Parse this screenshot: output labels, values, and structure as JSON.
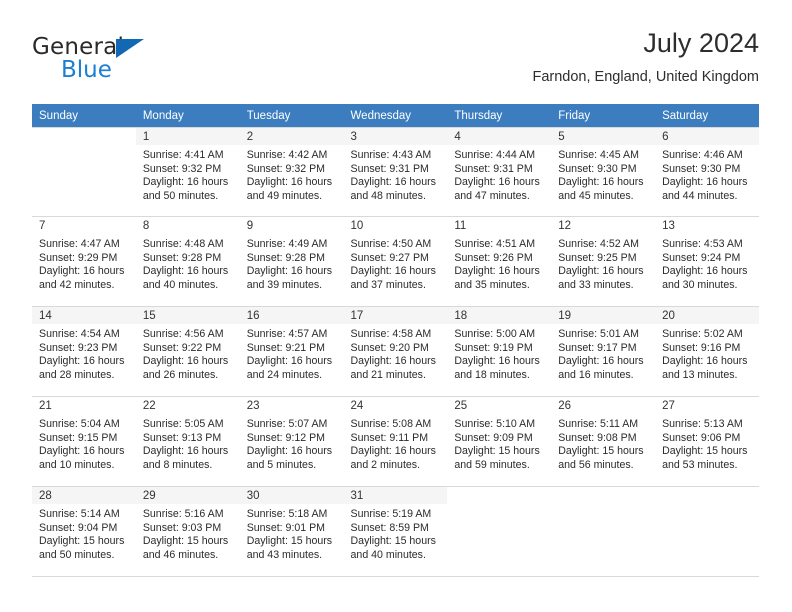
{
  "brand": {
    "line1": "General",
    "line2": "Blue",
    "triangle_color": "#1268b3",
    "blue_color": "#1b7fd4"
  },
  "header": {
    "title": "July 2024",
    "subtitle": "Farndon, England, United Kingdom"
  },
  "theme": {
    "header_row_bg": "#3b7dbf",
    "header_row_text": "#ffffff",
    "alt_row_bg": "#f5f5f5",
    "grid_line": "#d9d9d9"
  },
  "weekdays": [
    "Sunday",
    "Monday",
    "Tuesday",
    "Wednesday",
    "Thursday",
    "Friday",
    "Saturday"
  ],
  "weeks": [
    [
      {
        "day": "",
        "sunrise": "",
        "sunset": "",
        "daylight1": "",
        "daylight2": ""
      },
      {
        "day": "1",
        "sunrise": "Sunrise: 4:41 AM",
        "sunset": "Sunset: 9:32 PM",
        "daylight1": "Daylight: 16 hours",
        "daylight2": "and 50 minutes."
      },
      {
        "day": "2",
        "sunrise": "Sunrise: 4:42 AM",
        "sunset": "Sunset: 9:32 PM",
        "daylight1": "Daylight: 16 hours",
        "daylight2": "and 49 minutes."
      },
      {
        "day": "3",
        "sunrise": "Sunrise: 4:43 AM",
        "sunset": "Sunset: 9:31 PM",
        "daylight1": "Daylight: 16 hours",
        "daylight2": "and 48 minutes."
      },
      {
        "day": "4",
        "sunrise": "Sunrise: 4:44 AM",
        "sunset": "Sunset: 9:31 PM",
        "daylight1": "Daylight: 16 hours",
        "daylight2": "and 47 minutes."
      },
      {
        "day": "5",
        "sunrise": "Sunrise: 4:45 AM",
        "sunset": "Sunset: 9:30 PM",
        "daylight1": "Daylight: 16 hours",
        "daylight2": "and 45 minutes."
      },
      {
        "day": "6",
        "sunrise": "Sunrise: 4:46 AM",
        "sunset": "Sunset: 9:30 PM",
        "daylight1": "Daylight: 16 hours",
        "daylight2": "and 44 minutes."
      }
    ],
    [
      {
        "day": "7",
        "sunrise": "Sunrise: 4:47 AM",
        "sunset": "Sunset: 9:29 PM",
        "daylight1": "Daylight: 16 hours",
        "daylight2": "and 42 minutes."
      },
      {
        "day": "8",
        "sunrise": "Sunrise: 4:48 AM",
        "sunset": "Sunset: 9:28 PM",
        "daylight1": "Daylight: 16 hours",
        "daylight2": "and 40 minutes."
      },
      {
        "day": "9",
        "sunrise": "Sunrise: 4:49 AM",
        "sunset": "Sunset: 9:28 PM",
        "daylight1": "Daylight: 16 hours",
        "daylight2": "and 39 minutes."
      },
      {
        "day": "10",
        "sunrise": "Sunrise: 4:50 AM",
        "sunset": "Sunset: 9:27 PM",
        "daylight1": "Daylight: 16 hours",
        "daylight2": "and 37 minutes."
      },
      {
        "day": "11",
        "sunrise": "Sunrise: 4:51 AM",
        "sunset": "Sunset: 9:26 PM",
        "daylight1": "Daylight: 16 hours",
        "daylight2": "and 35 minutes."
      },
      {
        "day": "12",
        "sunrise": "Sunrise: 4:52 AM",
        "sunset": "Sunset: 9:25 PM",
        "daylight1": "Daylight: 16 hours",
        "daylight2": "and 33 minutes."
      },
      {
        "day": "13",
        "sunrise": "Sunrise: 4:53 AM",
        "sunset": "Sunset: 9:24 PM",
        "daylight1": "Daylight: 16 hours",
        "daylight2": "and 30 minutes."
      }
    ],
    [
      {
        "day": "14",
        "sunrise": "Sunrise: 4:54 AM",
        "sunset": "Sunset: 9:23 PM",
        "daylight1": "Daylight: 16 hours",
        "daylight2": "and 28 minutes."
      },
      {
        "day": "15",
        "sunrise": "Sunrise: 4:56 AM",
        "sunset": "Sunset: 9:22 PM",
        "daylight1": "Daylight: 16 hours",
        "daylight2": "and 26 minutes."
      },
      {
        "day": "16",
        "sunrise": "Sunrise: 4:57 AM",
        "sunset": "Sunset: 9:21 PM",
        "daylight1": "Daylight: 16 hours",
        "daylight2": "and 24 minutes."
      },
      {
        "day": "17",
        "sunrise": "Sunrise: 4:58 AM",
        "sunset": "Sunset: 9:20 PM",
        "daylight1": "Daylight: 16 hours",
        "daylight2": "and 21 minutes."
      },
      {
        "day": "18",
        "sunrise": "Sunrise: 5:00 AM",
        "sunset": "Sunset: 9:19 PM",
        "daylight1": "Daylight: 16 hours",
        "daylight2": "and 18 minutes."
      },
      {
        "day": "19",
        "sunrise": "Sunrise: 5:01 AM",
        "sunset": "Sunset: 9:17 PM",
        "daylight1": "Daylight: 16 hours",
        "daylight2": "and 16 minutes."
      },
      {
        "day": "20",
        "sunrise": "Sunrise: 5:02 AM",
        "sunset": "Sunset: 9:16 PM",
        "daylight1": "Daylight: 16 hours",
        "daylight2": "and 13 minutes."
      }
    ],
    [
      {
        "day": "21",
        "sunrise": "Sunrise: 5:04 AM",
        "sunset": "Sunset: 9:15 PM",
        "daylight1": "Daylight: 16 hours",
        "daylight2": "and 10 minutes."
      },
      {
        "day": "22",
        "sunrise": "Sunrise: 5:05 AM",
        "sunset": "Sunset: 9:13 PM",
        "daylight1": "Daylight: 16 hours",
        "daylight2": "and 8 minutes."
      },
      {
        "day": "23",
        "sunrise": "Sunrise: 5:07 AM",
        "sunset": "Sunset: 9:12 PM",
        "daylight1": "Daylight: 16 hours",
        "daylight2": "and 5 minutes."
      },
      {
        "day": "24",
        "sunrise": "Sunrise: 5:08 AM",
        "sunset": "Sunset: 9:11 PM",
        "daylight1": "Daylight: 16 hours",
        "daylight2": "and 2 minutes."
      },
      {
        "day": "25",
        "sunrise": "Sunrise: 5:10 AM",
        "sunset": "Sunset: 9:09 PM",
        "daylight1": "Daylight: 15 hours",
        "daylight2": "and 59 minutes."
      },
      {
        "day": "26",
        "sunrise": "Sunrise: 5:11 AM",
        "sunset": "Sunset: 9:08 PM",
        "daylight1": "Daylight: 15 hours",
        "daylight2": "and 56 minutes."
      },
      {
        "day": "27",
        "sunrise": "Sunrise: 5:13 AM",
        "sunset": "Sunset: 9:06 PM",
        "daylight1": "Daylight: 15 hours",
        "daylight2": "and 53 minutes."
      }
    ],
    [
      {
        "day": "28",
        "sunrise": "Sunrise: 5:14 AM",
        "sunset": "Sunset: 9:04 PM",
        "daylight1": "Daylight: 15 hours",
        "daylight2": "and 50 minutes."
      },
      {
        "day": "29",
        "sunrise": "Sunrise: 5:16 AM",
        "sunset": "Sunset: 9:03 PM",
        "daylight1": "Daylight: 15 hours",
        "daylight2": "and 46 minutes."
      },
      {
        "day": "30",
        "sunrise": "Sunrise: 5:18 AM",
        "sunset": "Sunset: 9:01 PM",
        "daylight1": "Daylight: 15 hours",
        "daylight2": "and 43 minutes."
      },
      {
        "day": "31",
        "sunrise": "Sunrise: 5:19 AM",
        "sunset": "Sunset: 8:59 PM",
        "daylight1": "Daylight: 15 hours",
        "daylight2": "and 40 minutes."
      },
      {
        "day": "",
        "sunrise": "",
        "sunset": "",
        "daylight1": "",
        "daylight2": ""
      },
      {
        "day": "",
        "sunrise": "",
        "sunset": "",
        "daylight1": "",
        "daylight2": ""
      },
      {
        "day": "",
        "sunrise": "",
        "sunset": "",
        "daylight1": "",
        "daylight2": ""
      }
    ]
  ]
}
